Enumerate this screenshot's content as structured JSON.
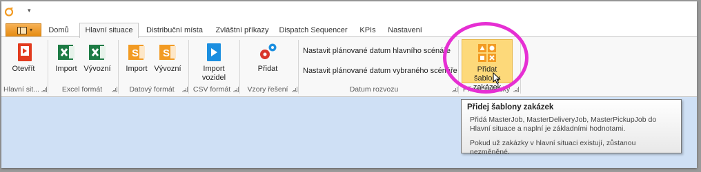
{
  "tabs": [
    "Domů",
    "Hlavní situace",
    "Distribuční místa",
    "Zvláštní příkazy",
    "Dispatch Sequencer",
    "KPIs",
    "Nastavení"
  ],
  "active_tab": "Hlavní situace",
  "ribbon": {
    "open_label": "Otevřít",
    "excel_import_label": "Import",
    "excel_export_label": "Vývozní",
    "data_import_label": "Import",
    "data_export_label": "Vývozní",
    "csv_import_label": "Import vozidel",
    "add_label": "Přidat",
    "set_date_main": "Nastavit plánované datum hlavního scénáře",
    "set_date_selected": "Nastavit plánované datum vybraného scénáře",
    "add_templates_label": "Přidat šablony zakázek"
  },
  "groups": {
    "main_situation": "Hlavní sit...",
    "excel_format": "Excel formát",
    "data_format": "Datový formát",
    "csv_format": "CSV formát",
    "solution_patterns": "Vzory řešení",
    "date_range": "Datum rozvozu",
    "add_orders": "Přidat zakázky"
  },
  "tooltip": {
    "title": "Přidej šablony zakázek",
    "body": "Přidá MasterJob, MasterDeliveryJob, MasterPickupJob do Hlavní situace a naplní je základními hodnotami.",
    "note": "Pokud už zakázky v hlavní situaci existují, zůstanou nezměněné."
  },
  "colors": {
    "accent_orange": "#f29b23",
    "excel_green": "#1e7b45",
    "csv_blue": "#1c8fe0",
    "highlight_circle": "#e62fd3",
    "content_bg": "#cfe0f5"
  }
}
